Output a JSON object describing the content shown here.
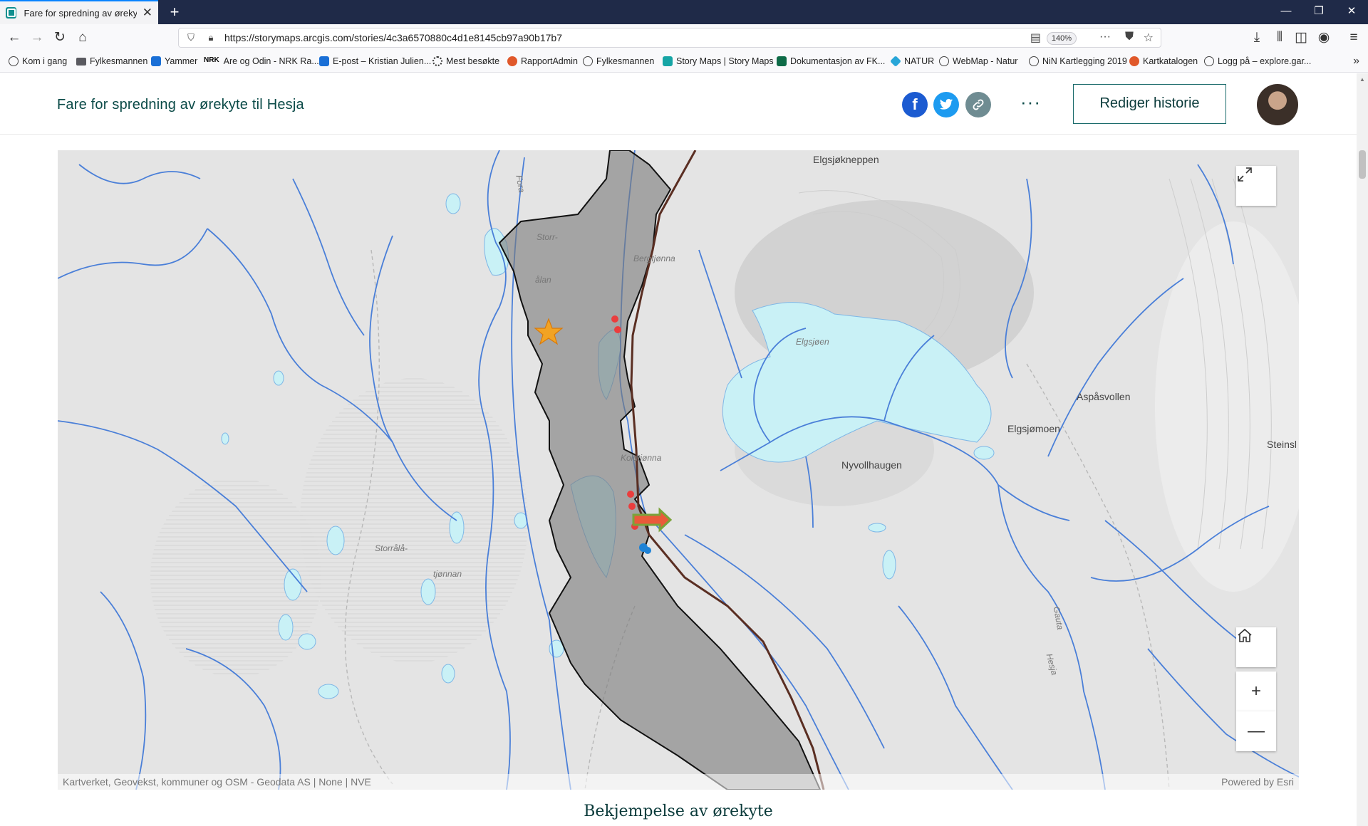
{
  "browser": {
    "tab_title": "Fare for spredning av ørekyte til",
    "url": "https://storymaps.arcgis.com/stories/4c3a6570880c4d1e8145cb97a90b17b7",
    "zoom": "140%",
    "bookmarks": [
      {
        "label": "Kom i gang",
        "icon": "globe"
      },
      {
        "label": "Fylkesmannen",
        "icon": "folder"
      },
      {
        "label": "Yammer",
        "icon": "blue"
      },
      {
        "label": "Are og Odin - NRK Ra...",
        "icon": "nrk"
      },
      {
        "label": "E-post – Kristian Julien...",
        "icon": "blue"
      },
      {
        "label": "Mest besøkte",
        "icon": "gear"
      },
      {
        "label": "RapportAdmin",
        "icon": "orange"
      },
      {
        "label": "Fylkesmannen",
        "icon": "globe"
      },
      {
        "label": "Story Maps | Story Maps",
        "icon": "teal"
      },
      {
        "label": "Dokumentasjon av FK...",
        "icon": "green"
      },
      {
        "label": "NATUR",
        "icon": "cyan"
      },
      {
        "label": "WebMap - Natur",
        "icon": "globe"
      },
      {
        "label": "NiN Kartlegging 2019",
        "icon": "globe"
      },
      {
        "label": "Kartkatalogen",
        "icon": "orange"
      },
      {
        "label": "Logg på – explore.gar...",
        "icon": "globe"
      }
    ]
  },
  "header": {
    "title": "Fare for spredning av ørekyte til Hesja",
    "edit_label": "Rediger historie",
    "more_label": "···"
  },
  "map": {
    "places": {
      "elgsjoknappen": "Elgsjøkneppen",
      "aspasvollen": "Aspåsvollen",
      "elgsjomoen": "Elgsjømoen",
      "nyvollhaugen": "Nyvollhaugen",
      "steinsl": "Steinsl",
      "storr": "Storr-",
      "alan": "ålan",
      "bergtjonna": "Bergtjønna",
      "elgsjoen": "Elgsjøen",
      "koldtjonna": "Koldtjønna",
      "storrala": "Storrålå-",
      "tjonnan": "tjønnan",
      "fora": "Fora",
      "hesja": "Hesja",
      "gauta": "Gauta"
    },
    "attribution": "Kartverket, Geovekst, kommuner og OSM - Geodata AS | None | NVE",
    "powered_by": "Powered by Esri"
  },
  "section_heading": "Bekjempelse av ørekyte"
}
